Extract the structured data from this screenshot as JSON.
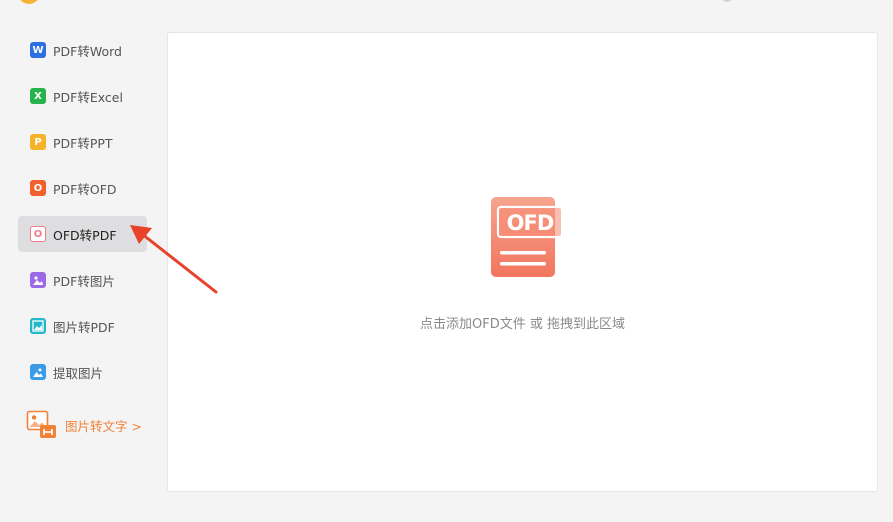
{
  "sidebar": {
    "items": [
      {
        "label": "PDF转Word",
        "icon": "word-icon",
        "color": "#2b6fe0",
        "glyph": "W",
        "active": false
      },
      {
        "label": "PDF转Excel",
        "icon": "excel-icon",
        "color": "#27b34b",
        "glyph": "X",
        "active": false
      },
      {
        "label": "PDF转PPT",
        "icon": "ppt-icon",
        "color": "#f5b32a",
        "glyph": "P",
        "active": false
      },
      {
        "label": "PDF转OFD",
        "icon": "ofd-icon",
        "color": "#f0612c",
        "glyph": "O",
        "active": false
      },
      {
        "label": "OFD转PDF",
        "icon": "ofd-to-pdf-icon",
        "color": "#f07a8a",
        "glyph": "O",
        "active": true
      },
      {
        "label": "PDF转图片",
        "icon": "pdf-to-image-icon",
        "color": "#9b6ae6",
        "glyph": "",
        "active": false
      },
      {
        "label": "图片转PDF",
        "icon": "image-to-pdf-icon",
        "color": "#22b8c9",
        "glyph": "",
        "active": false
      },
      {
        "label": "提取图片",
        "icon": "extract-image-icon",
        "color": "#3a9be8",
        "glyph": "",
        "active": false
      }
    ],
    "promo_label": "图片转文字 >",
    "promo_color": "#f08235"
  },
  "main": {
    "file_badge": "OFD",
    "drop_hint": "点击添加OFD文件 或 拖拽到此区域",
    "accent": "#f58a72"
  },
  "annotation": {
    "arrow_color": "#e8422a"
  }
}
